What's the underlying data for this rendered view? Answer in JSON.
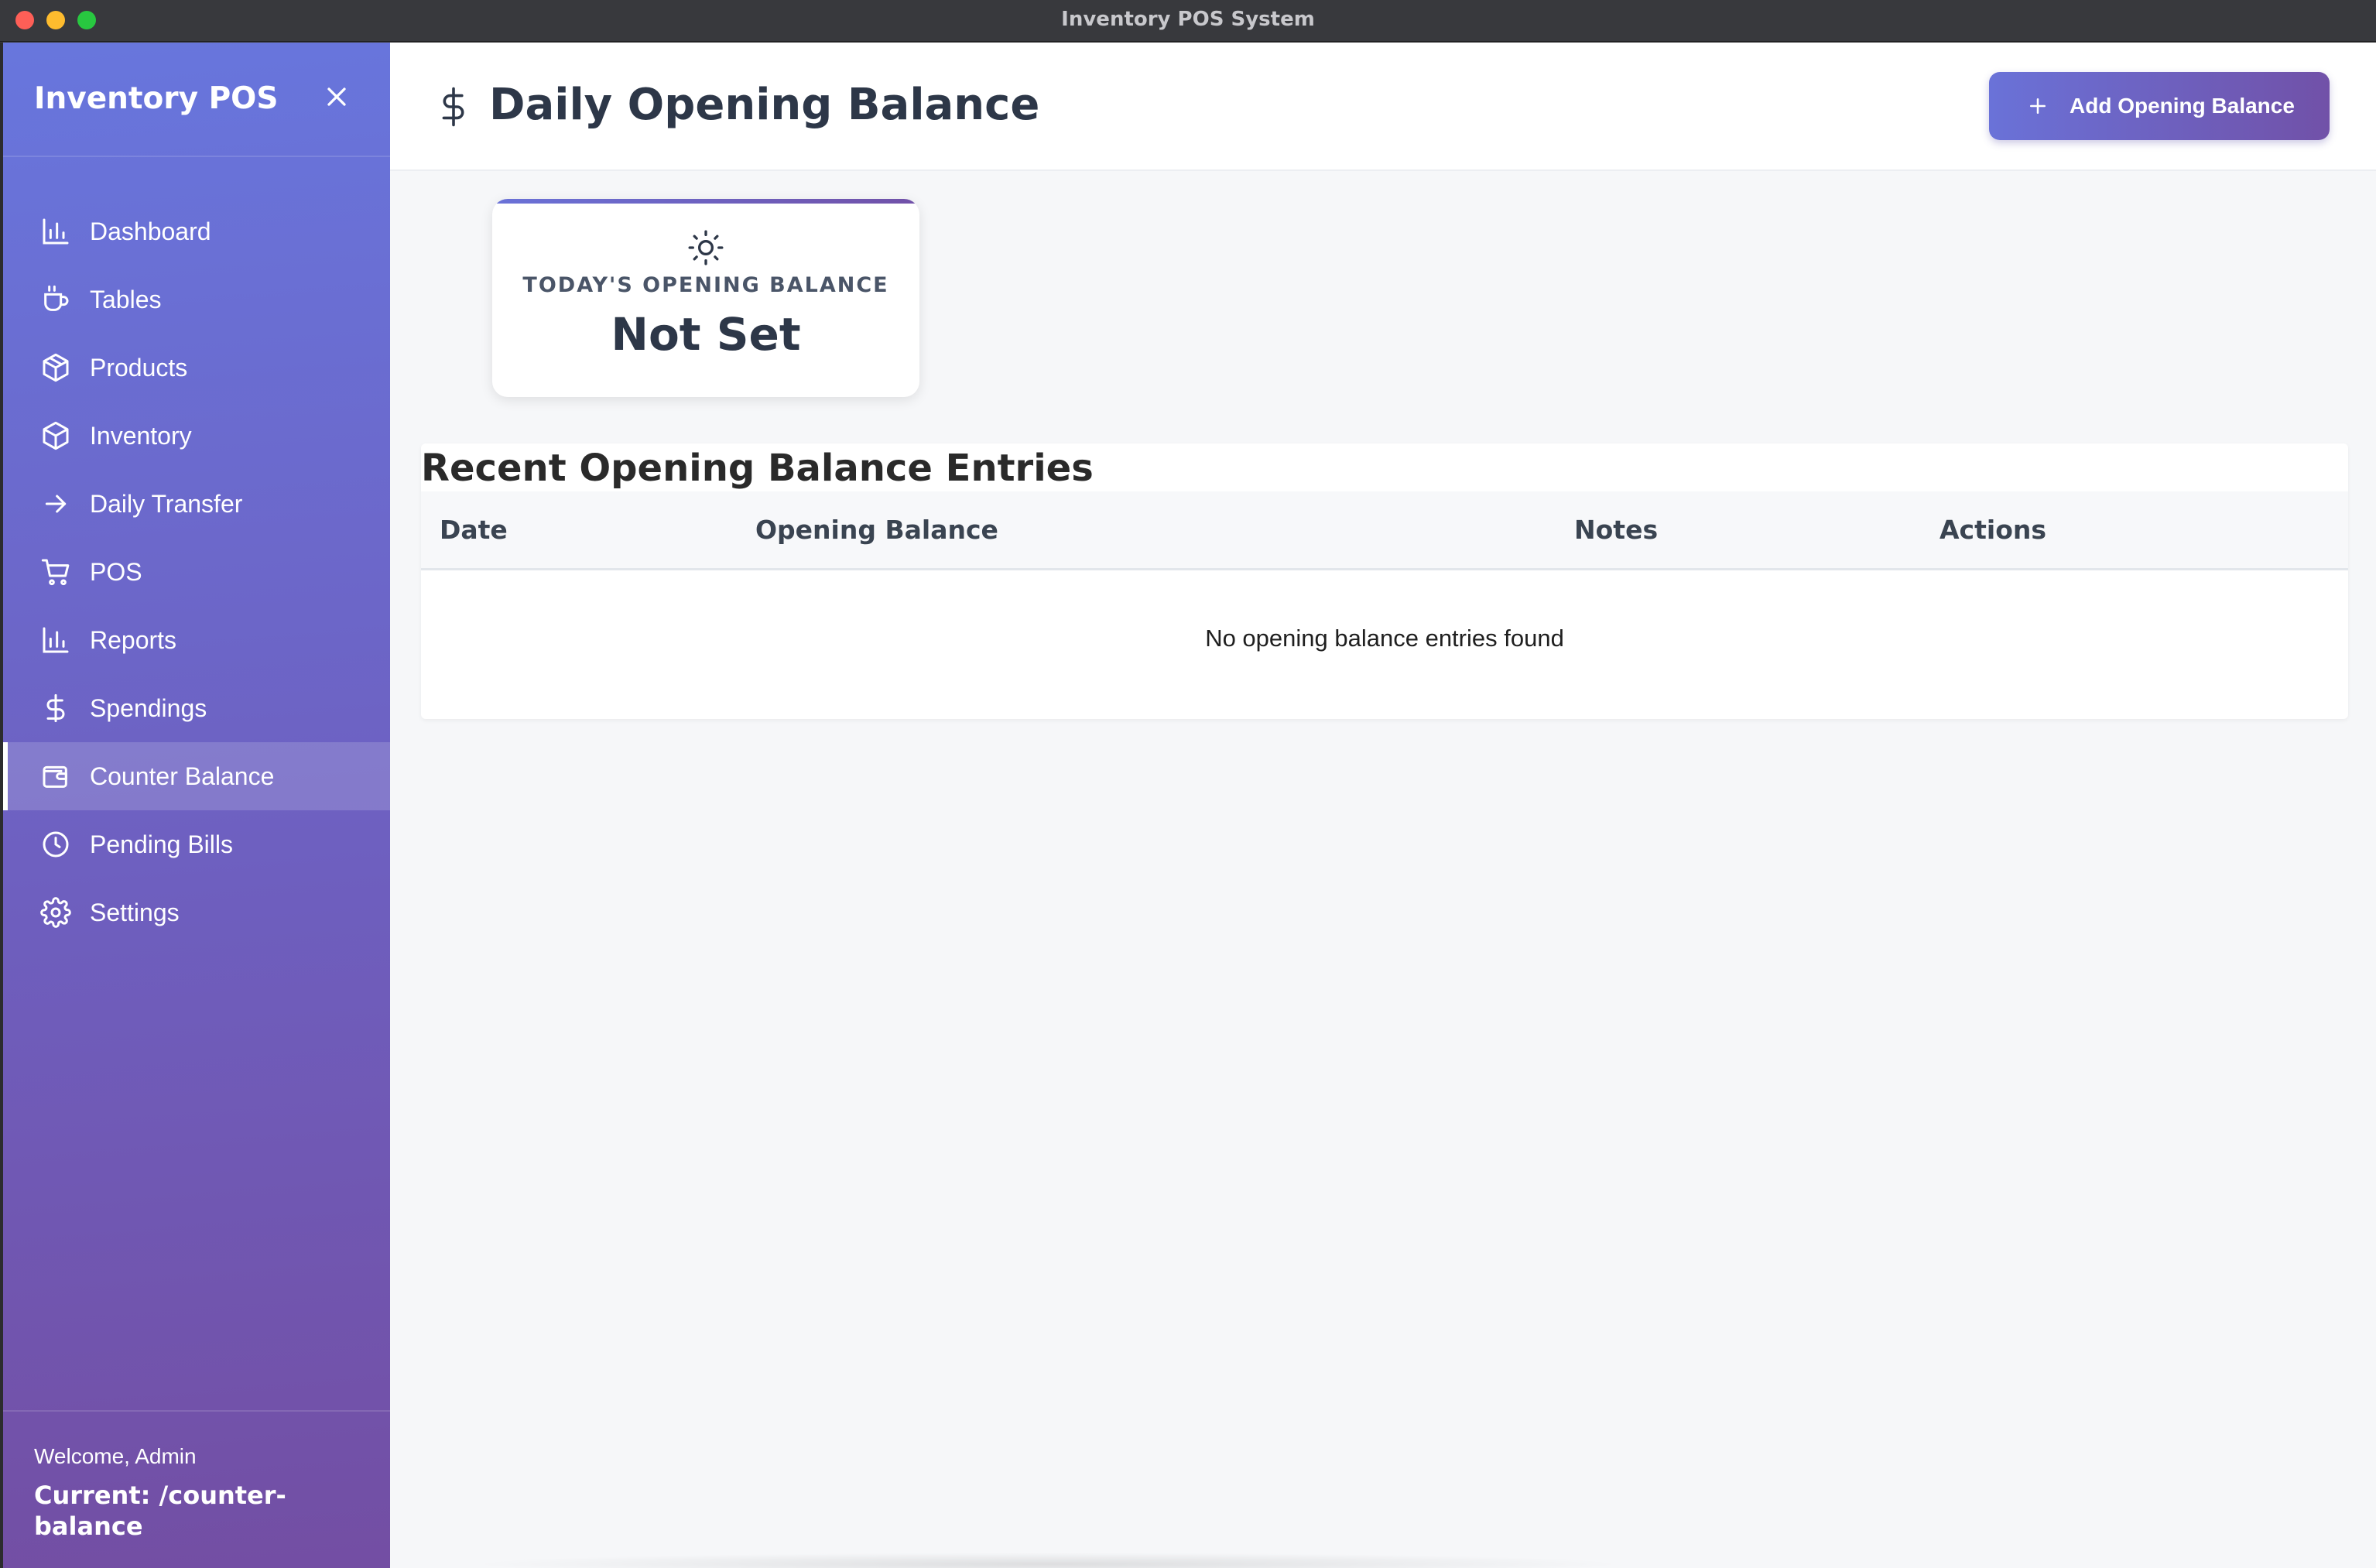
{
  "window": {
    "title": "Inventory POS System"
  },
  "sidebar": {
    "brand": "Inventory POS",
    "close_icon": "close-icon",
    "items": [
      {
        "label": "Dashboard",
        "icon": "bar-chart-icon",
        "active": false
      },
      {
        "label": "Tables",
        "icon": "coffee-cup-icon",
        "active": false
      },
      {
        "label": "Products",
        "icon": "package-icon",
        "active": false
      },
      {
        "label": "Inventory",
        "icon": "package-icon",
        "active": false
      },
      {
        "label": "Daily Transfer",
        "icon": "arrow-right-icon",
        "active": false
      },
      {
        "label": "POS",
        "icon": "shopping-cart-icon",
        "active": false
      },
      {
        "label": "Reports",
        "icon": "bar-chart-icon",
        "active": false
      },
      {
        "label": "Spendings",
        "icon": "dollar-icon",
        "active": false
      },
      {
        "label": "Counter Balance",
        "icon": "wallet-icon",
        "active": true
      },
      {
        "label": "Pending Bills",
        "icon": "clock-icon",
        "active": false
      },
      {
        "label": "Settings",
        "icon": "gear-icon",
        "active": false
      }
    ],
    "footer": {
      "welcome": "Welcome, Admin",
      "current": "Current: /counter-balance"
    }
  },
  "header": {
    "icon": "dollar-icon",
    "title": "Daily Opening Balance",
    "add_button_label": "Add Opening Balance",
    "add_button_icon": "plus-icon"
  },
  "balance_card": {
    "icon": "sun-icon",
    "label": "TODAY'S OPENING BALANCE",
    "value": "Not Set"
  },
  "entries": {
    "title": "Recent Opening Balance Entries",
    "columns": [
      "Date",
      "Opening Balance",
      "Notes",
      "Actions"
    ],
    "rows": [],
    "empty_message": "No opening balance entries found"
  },
  "colors": {
    "accent_start": "#6a72d8",
    "accent_end": "#7151a8",
    "title_text": "#2d3748"
  }
}
